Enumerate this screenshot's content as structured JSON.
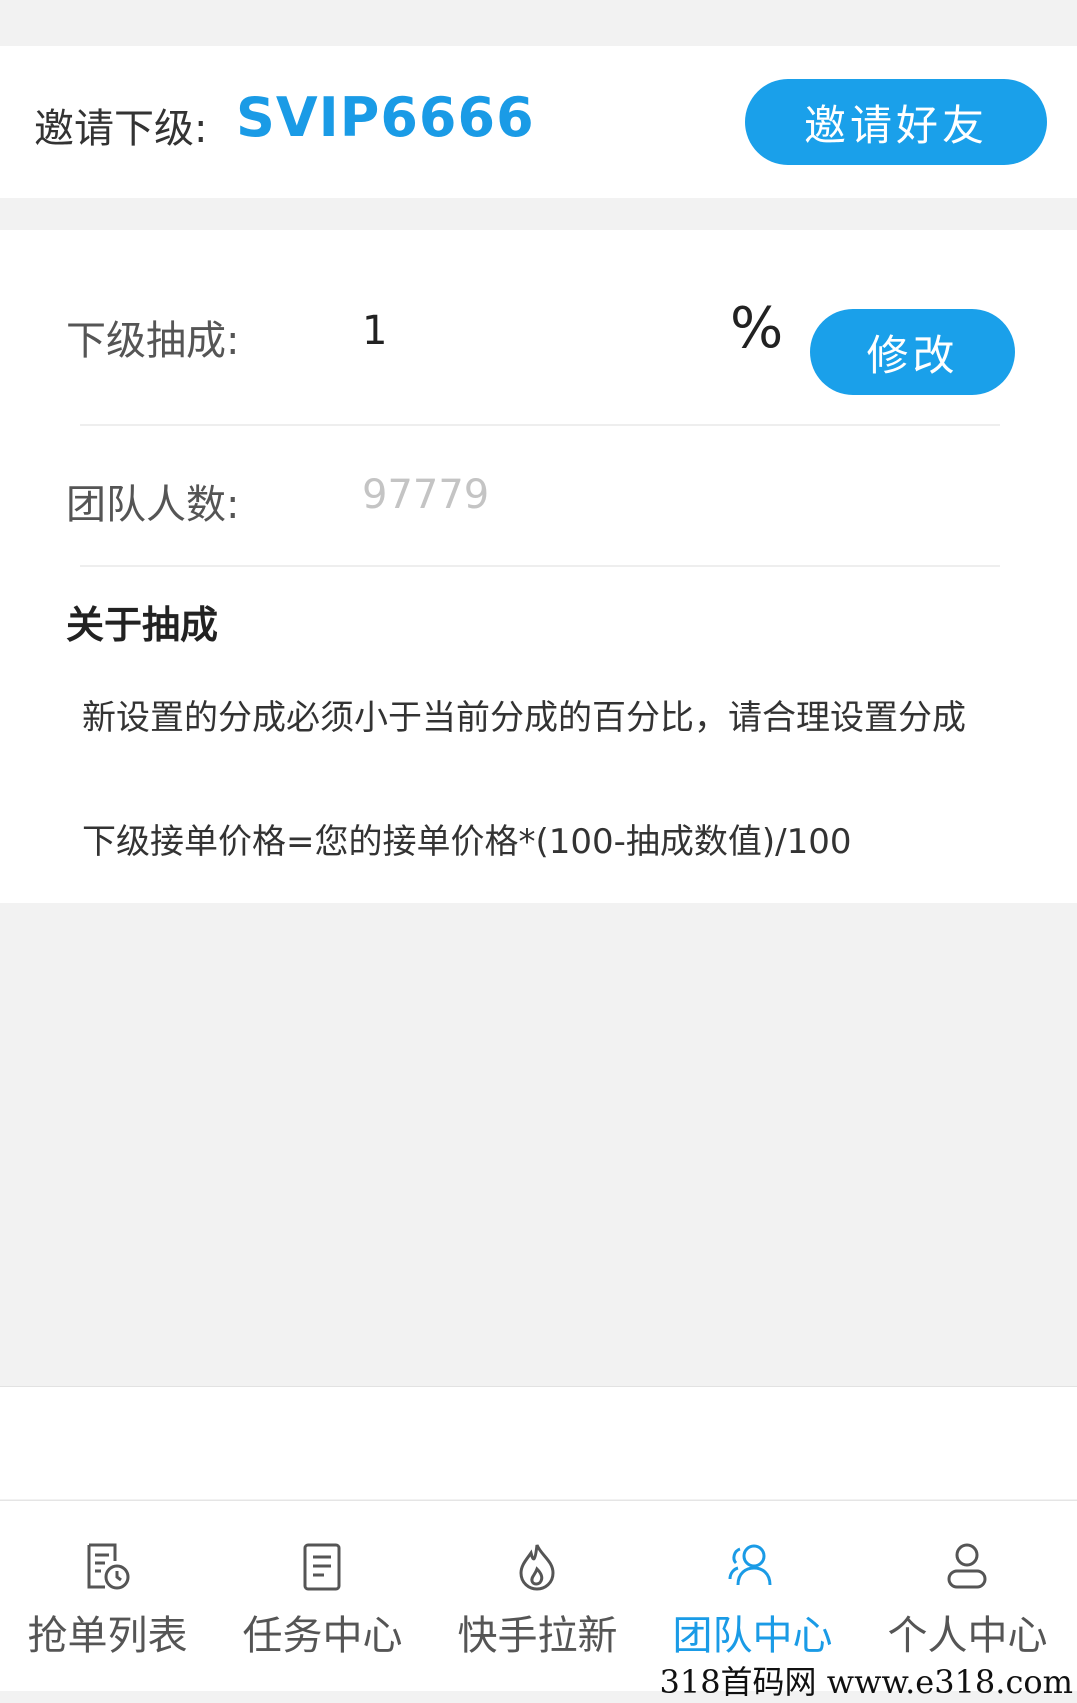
{
  "invite": {
    "label": "邀请下级:",
    "code": "SVIP6666",
    "button_label": "邀请好友"
  },
  "commission": {
    "label": "下级抽成:",
    "value": "1",
    "unit": "%",
    "modify_label": "修改"
  },
  "team": {
    "label": "团队人数:",
    "placeholder": "97779"
  },
  "about": {
    "title": "关于抽成",
    "paragraph1": "新设置的分成必须小于当前分成的百分比，请合理设置分成",
    "paragraph2": "下级接单价格=您的接单价格*(100-抽成数值)/100"
  },
  "tabbar": {
    "items": [
      {
        "label": "抢单列表",
        "icon": "order-list-icon",
        "active": false
      },
      {
        "label": "任务中心",
        "icon": "task-document-icon",
        "active": false
      },
      {
        "label": "快手拉新",
        "icon": "flame-icon",
        "active": false
      },
      {
        "label": "团队中心",
        "icon": "team-users-icon",
        "active": true
      },
      {
        "label": "个人中心",
        "icon": "user-profile-icon",
        "active": false
      }
    ]
  },
  "colors": {
    "accent": "#1a9be6",
    "button": "#1aa0ea",
    "inactive_tab": "#555555"
  },
  "watermark": "318首码网  www.e318.com"
}
